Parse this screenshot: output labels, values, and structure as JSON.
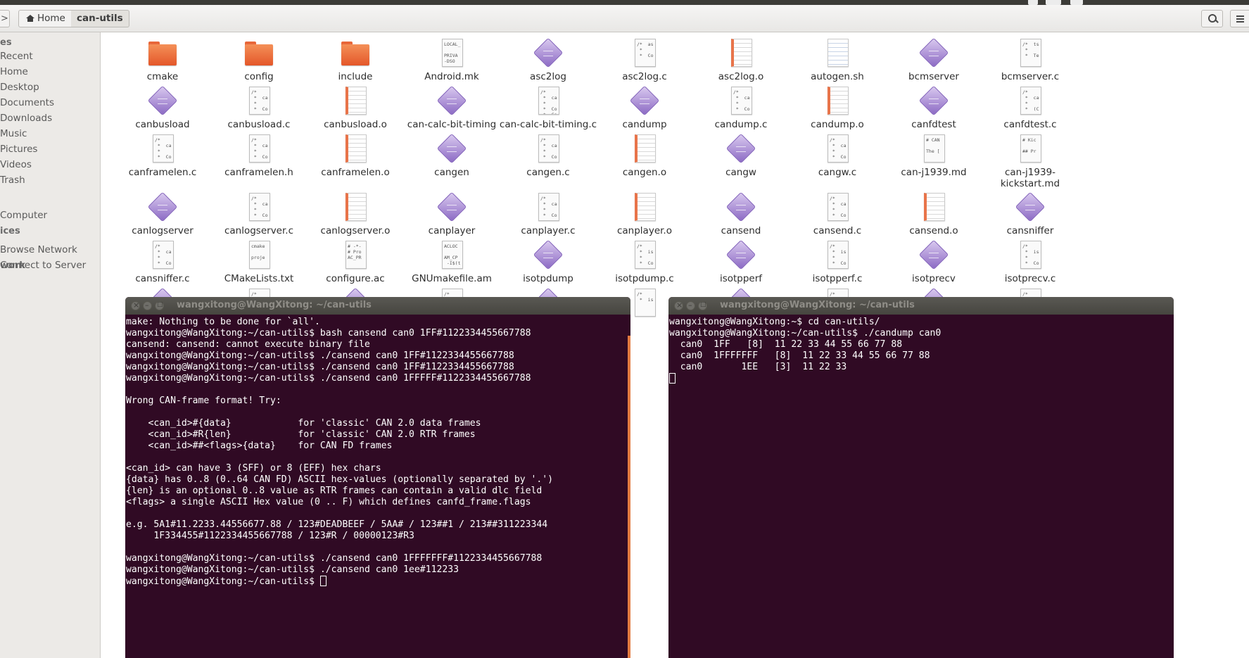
{
  "toolbar": {
    "home_label": "Home",
    "current_folder": "can-utils"
  },
  "sidebar": {
    "sections": [
      {
        "heading": "es",
        "items": [
          "Recent",
          "Home",
          "Desktop",
          "Documents",
          "Downloads",
          "Music",
          "Pictures",
          "Videos",
          "Trash"
        ]
      },
      {
        "heading": "ices",
        "items": [
          "Computer"
        ]
      },
      {
        "heading": "work",
        "items": [
          "Browse Network",
          "Connect to Server"
        ]
      }
    ]
  },
  "files": [
    {
      "name": "cmake",
      "type": "folder"
    },
    {
      "name": "config",
      "type": "folder"
    },
    {
      "name": "include",
      "type": "folder"
    },
    {
      "name": "Android.mk",
      "type": "doc",
      "preview": "LOCAL_\n\nPRIVA\n-DSO"
    },
    {
      "name": "asc2log",
      "type": "exe"
    },
    {
      "name": "asc2log.c",
      "type": "doc",
      "preview": "/*  as\n *\n *  Co"
    },
    {
      "name": "asc2log.o",
      "type": "obj"
    },
    {
      "name": "autogen.sh",
      "type": "sh"
    },
    {
      "name": "bcmserver",
      "type": "exe"
    },
    {
      "name": "bcmserver.c",
      "type": "doc",
      "preview": "/*  ts\n *\n *  Te"
    },
    {
      "name": "canbusload",
      "type": "exe"
    },
    {
      "name": "canbusload.c",
      "type": "doc",
      "preview": "/*\n *  ca\n *\n *  Co"
    },
    {
      "name": "canbusload.o",
      "type": "obj"
    },
    {
      "name": "can-calc-bit-timing",
      "type": "exe"
    },
    {
      "name": "can-calc-bit-timing.c",
      "type": "doc",
      "preview": "/*\n *  ca\n *\n *  Co\n *  Co"
    },
    {
      "name": "candump",
      "type": "exe"
    },
    {
      "name": "candump.c",
      "type": "doc",
      "preview": "/*\n *  ca\n *\n *  Co"
    },
    {
      "name": "candump.o",
      "type": "obj"
    },
    {
      "name": "canfdtest",
      "type": "exe"
    },
    {
      "name": "canfdtest.c",
      "type": "doc",
      "preview": "/*\n *  ca\n *\n *  (C"
    },
    {
      "name": "canframelen.c",
      "type": "doc",
      "preview": "/*\n *  ca\n *\n *  Co"
    },
    {
      "name": "canframelen.h",
      "type": "doc",
      "preview": "/*\n *  ca\n *\n *  Co"
    },
    {
      "name": "canframelen.o",
      "type": "obj"
    },
    {
      "name": "cangen",
      "type": "exe"
    },
    {
      "name": "cangen.c",
      "type": "doc",
      "preview": "/*\n *  ca\n *\n *  Co"
    },
    {
      "name": "cangen.o",
      "type": "obj"
    },
    {
      "name": "cangw",
      "type": "exe"
    },
    {
      "name": "cangw.c",
      "type": "doc",
      "preview": "/*\n *  ca\n *\n *  Co"
    },
    {
      "name": "can-j1939.md",
      "type": "doc",
      "preview": "# CAN\n\nThe [\n"
    },
    {
      "name": "can-j1939-kickstart.md",
      "type": "doc",
      "preview": "# Kic\n\n## Pr\n"
    },
    {
      "name": "canlogserver",
      "type": "exe"
    },
    {
      "name": "canlogserver.c",
      "type": "doc",
      "preview": "/*\n *  ca\n *\n *  Co"
    },
    {
      "name": "canlogserver.o",
      "type": "obj"
    },
    {
      "name": "canplayer",
      "type": "exe"
    },
    {
      "name": "canplayer.c",
      "type": "doc",
      "preview": "/*\n *  ca\n *\n *  Co"
    },
    {
      "name": "canplayer.o",
      "type": "obj"
    },
    {
      "name": "cansend",
      "type": "exe"
    },
    {
      "name": "cansend.c",
      "type": "doc",
      "preview": "/*\n *  ca\n *\n *  Co"
    },
    {
      "name": "cansend.o",
      "type": "obj"
    },
    {
      "name": "cansniffer",
      "type": "exe"
    },
    {
      "name": "cansniffer.c",
      "type": "doc",
      "preview": "/*\n *  ca\n *\n *  Co"
    },
    {
      "name": "CMakeLists.txt",
      "type": "doc",
      "preview": "cmake\n\nproje\n"
    },
    {
      "name": "configure.ac",
      "type": "doc",
      "preview": "# -*-\n# Pro\nAC_PR\n"
    },
    {
      "name": "GNUmakefile.am",
      "type": "doc",
      "preview": "ACLOC\n\nAM_CP\n -I$(t"
    },
    {
      "name": "isotpdump",
      "type": "exe"
    },
    {
      "name": "isotpdump.c",
      "type": "doc",
      "preview": "/*\n *  is\n *\n *  Co"
    },
    {
      "name": "isotpperf",
      "type": "exe"
    },
    {
      "name": "isotpperf.c",
      "type": "doc",
      "preview": "/*\n *  is\n *\n *  Co"
    },
    {
      "name": "isotprecv",
      "type": "exe"
    },
    {
      "name": "isotprecv.c",
      "type": "doc",
      "preview": "/*\n *  is\n *\n *  Co"
    },
    {
      "name": "",
      "type": "exe"
    },
    {
      "name": "",
      "type": "doc",
      "preview": "/*\n *  is"
    },
    {
      "name": "",
      "type": "exe"
    },
    {
      "name": "",
      "type": "doc",
      "preview": "/*\n *  is"
    },
    {
      "name": "",
      "type": "exe"
    },
    {
      "name": "",
      "type": "doc",
      "preview": "/*\n *  is"
    },
    {
      "name": "",
      "type": "exe"
    },
    {
      "name": "",
      "type": "doc",
      "preview": "/*\n *  is"
    },
    {
      "name": "",
      "type": "exe"
    },
    {
      "name": "",
      "type": "doc",
      "preview": "/*\n *  is"
    }
  ],
  "terminal_left": {
    "title": "wangxitong@WangXitong: ~/can-utils",
    "lines": [
      "make: Nothing to be done for `all'.",
      "wangxitong@WangXitong:~/can-utils$ bash cansend can0 1FF#1122334455667788",
      "cansend: cansend: cannot execute binary file",
      "wangxitong@WangXitong:~/can-utils$ ./cansend can0 1FF#1122334455667788",
      "wangxitong@WangXitong:~/can-utils$ ./cansend can0 1FF#1122334455667788",
      "wangxitong@WangXitong:~/can-utils$ ./cansend can0 1FFFFF#1122334455667788",
      "",
      "Wrong CAN-frame format! Try:",
      "",
      "    <can_id>#{data}            for 'classic' CAN 2.0 data frames",
      "    <can_id>#R{len}            for 'classic' CAN 2.0 RTR frames",
      "    <can_id>##<flags>{data}    for CAN FD frames",
      "",
      "<can_id> can have 3 (SFF) or 8 (EFF) hex chars",
      "{data} has 0..8 (0..64 CAN FD) ASCII hex-values (optionally separated by '.')",
      "{len} is an optional 0..8 value as RTR frames can contain a valid dlc field",
      "<flags> a single ASCII Hex value (0 .. F) which defines canfd_frame.flags",
      "",
      "e.g. 5A1#11.2233.44556677.88 / 123#DEADBEEF / 5AA# / 123##1 / 213##311223344",
      "     1F334455#1122334455667788 / 123#R / 00000123#R3",
      "",
      "wangxitong@WangXitong:~/can-utils$ ./cansend can0 1FFFFFFF#1122334455667788",
      "wangxitong@WangXitong:~/can-utils$ ./cansend can0 1ee#112233",
      "wangxitong@WangXitong:~/can-utils$ "
    ]
  },
  "terminal_right": {
    "title": "wangxitong@WangXitong: ~/can-utils",
    "lines": [
      "wangxitong@WangXitong:~$ cd can-utils/",
      "wangxitong@WangXitong:~/can-utils$ ./candump can0",
      "  can0  1FF   [8]  11 22 33 44 55 66 77 88",
      "  can0  1FFFFFFF   [8]  11 22 33 44 55 66 77 88",
      "  can0       1EE   [3]  11 22 33",
      ""
    ]
  }
}
